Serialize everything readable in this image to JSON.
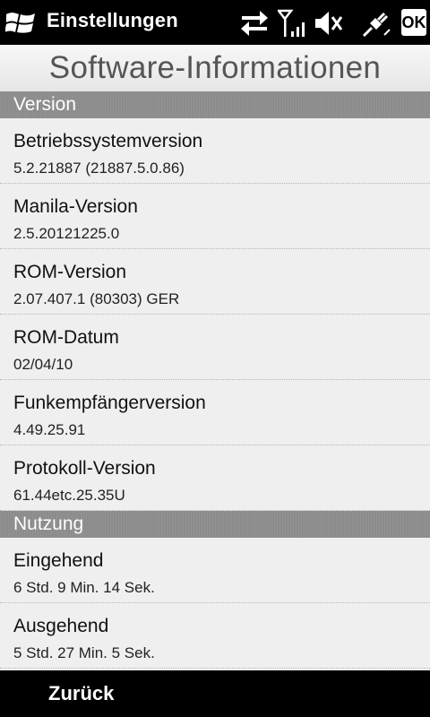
{
  "statusbar": {
    "app_title": "Einstellungen",
    "ok_label": "OK",
    "icons": [
      "windows-start-icon",
      "data-sync-arrows-icon",
      "signal-strength-icon",
      "speaker-muted-icon",
      "power-plug-icon"
    ]
  },
  "page": {
    "title": "Software-Informationen"
  },
  "sections": {
    "version": {
      "header": "Version",
      "items": [
        {
          "label": "Betriebssystemversion",
          "value": "5.2.21887 (21887.5.0.86)"
        },
        {
          "label": "Manila-Version",
          "value": "2.5.20121225.0"
        },
        {
          "label": "ROM-Version",
          "value": "2.07.407.1 (80303) GER"
        },
        {
          "label": "ROM-Datum",
          "value": "02/04/10"
        },
        {
          "label": "Funkempfängerversion",
          "value": "4.49.25.91"
        },
        {
          "label": "Protokoll-Version",
          "value": "61.44etc.25.35U"
        }
      ]
    },
    "nutzung": {
      "header": "Nutzung",
      "items": [
        {
          "label": "Eingehend",
          "value": "6 Std. 9 Min. 14 Sek."
        },
        {
          "label": "Ausgehend",
          "value": "5 Std. 27 Min. 5 Sek."
        }
      ]
    }
  },
  "softbar": {
    "left_label": "Zurück"
  }
}
